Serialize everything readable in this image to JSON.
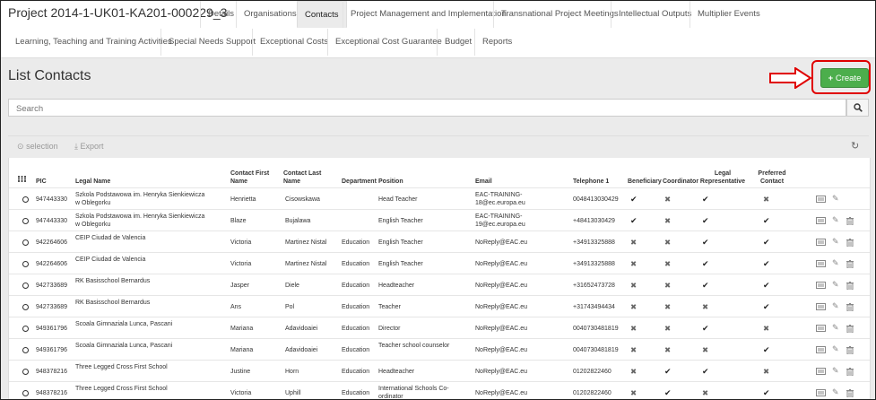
{
  "project": {
    "title": "Project 2014-1-UK01-KA201-000229_3",
    "tabs_row1": [
      "Details",
      "Organisations",
      "Contacts",
      "Project Management and Implementation",
      "Transnational Project Meetings",
      "Intellectual Outputs",
      "Multiplier Events"
    ],
    "tabs_row2": [
      "Learning, Teaching and Training Activities",
      "Special Needs Support",
      "Exceptional Costs",
      "Exceptional Cost Guarantee",
      "Budget",
      "Reports"
    ],
    "active_tab": "Contacts"
  },
  "page": {
    "title": "List Contacts",
    "create_label": "Create",
    "search_placeholder": "Search"
  },
  "toolbar": {
    "selection_label": "selection",
    "export_label": "Export"
  },
  "table": {
    "headers": {
      "pic": "PIC",
      "legal_name": "Legal Name",
      "first_name": "Contact First Name",
      "last_name": "Contact Last Name",
      "department": "Department",
      "position": "Position",
      "email": "Email",
      "telephone": "Telephone 1",
      "beneficiary": "Beneficiary",
      "coordinator": "Coordinator",
      "legal_rep": "Legal Representative",
      "preferred": "Preferred Contact"
    },
    "rows": [
      {
        "pic": "947443330",
        "legal_name": "Szkola Podstawowa im. Henryka Sienkiewicza w Oblegorku",
        "first": "Henrietta",
        "last": "Cisowskawa",
        "dept": "",
        "position": "Head Teacher",
        "email": "EAC-TRAINING-18@ec.europa.eu",
        "tel": "0048413030429",
        "beneficiary": true,
        "coordinator": false,
        "legal_rep": true,
        "preferred": false,
        "deletable": false
      },
      {
        "pic": "947443330",
        "legal_name": "Szkola Podstawowa im. Henryka Sienkiewicza w Oblegorku",
        "first": "Blaze",
        "last": "Bujalawa",
        "dept": "",
        "position": "English Teacher",
        "email": "EAC-TRAINING-19@ec.europa.eu",
        "tel": "+48413030429",
        "beneficiary": true,
        "coordinator": false,
        "legal_rep": true,
        "preferred": true,
        "deletable": true
      },
      {
        "pic": "942264606",
        "legal_name": "CEIP Ciudad de Valencia",
        "first": "Victoria",
        "last": "Martinez Nistal",
        "dept": "Education",
        "position": "English Teacher",
        "email": "NoReply@EAC.eu",
        "tel": "+34913325888",
        "beneficiary": false,
        "coordinator": false,
        "legal_rep": true,
        "preferred": true,
        "deletable": true
      },
      {
        "pic": "942264606",
        "legal_name": "CEIP Ciudad de Valencia",
        "first": "Victoria",
        "last": "Martinez Nistal",
        "dept": "Education",
        "position": "English Teacher",
        "email": "NoReply@EAC.eu",
        "tel": "+34913325888",
        "beneficiary": false,
        "coordinator": false,
        "legal_rep": true,
        "preferred": true,
        "deletable": true
      },
      {
        "pic": "942733689",
        "legal_name": "RK Basisschool Bernardus",
        "first": "Jasper",
        "last": "Diele",
        "dept": "Education",
        "position": "Headteacher",
        "email": "NoReply@EAC.eu",
        "tel": "+31652473728",
        "beneficiary": false,
        "coordinator": false,
        "legal_rep": true,
        "preferred": true,
        "deletable": true
      },
      {
        "pic": "942733689",
        "legal_name": "RK Basisschool Bernardus",
        "first": "Ans",
        "last": "Pol",
        "dept": "Education",
        "position": "Teacher",
        "email": "NoReply@EAC.eu",
        "tel": "+31743494434",
        "beneficiary": false,
        "coordinator": false,
        "legal_rep": false,
        "preferred": true,
        "deletable": true
      },
      {
        "pic": "949361796",
        "legal_name": "Scoala Gimnaziala Lunca, Pascani",
        "first": "Mariana",
        "last": "Adavidoaiei",
        "dept": "Education",
        "position": "Director",
        "email": "NoReply@EAC.eu",
        "tel": "0040730481819",
        "beneficiary": false,
        "coordinator": false,
        "legal_rep": true,
        "preferred": false,
        "deletable": true
      },
      {
        "pic": "949361796",
        "legal_name": "Scoala Gimnaziala Lunca, Pascani",
        "first": "Mariana",
        "last": "Adavidoaiei",
        "dept": "Education",
        "position": "Teacher school counselor",
        "email": "NoReply@EAC.eu",
        "tel": "0040730481819",
        "beneficiary": false,
        "coordinator": false,
        "legal_rep": false,
        "preferred": true,
        "deletable": true
      },
      {
        "pic": "948378216",
        "legal_name": "Three Legged Cross First School",
        "first": "Justine",
        "last": "Horn",
        "dept": "Education",
        "position": "Headteacher",
        "email": "NoReply@EAC.eu",
        "tel": "01202822460",
        "beneficiary": false,
        "coordinator": true,
        "legal_rep": true,
        "preferred": false,
        "deletable": true
      },
      {
        "pic": "948378216",
        "legal_name": "Three Legged Cross First School",
        "first": "Victoria",
        "last": "Uphill",
        "dept": "Education",
        "position": "International Schools Co-ordinator",
        "email": "NoReply@EAC.eu",
        "tel": "01202822460",
        "beneficiary": false,
        "coordinator": true,
        "legal_rep": false,
        "preferred": true,
        "deletable": true
      }
    ]
  },
  "colors": {
    "create_green": "#4cae4c",
    "annotation_red": "#e00000"
  },
  "icons": [
    "grid-icon",
    "radio-icon",
    "check-icon",
    "cross-icon",
    "keyboard-icon",
    "pencil-icon",
    "trash-icon",
    "search-icon",
    "refresh-icon",
    "plus-icon",
    "download-icon"
  ]
}
